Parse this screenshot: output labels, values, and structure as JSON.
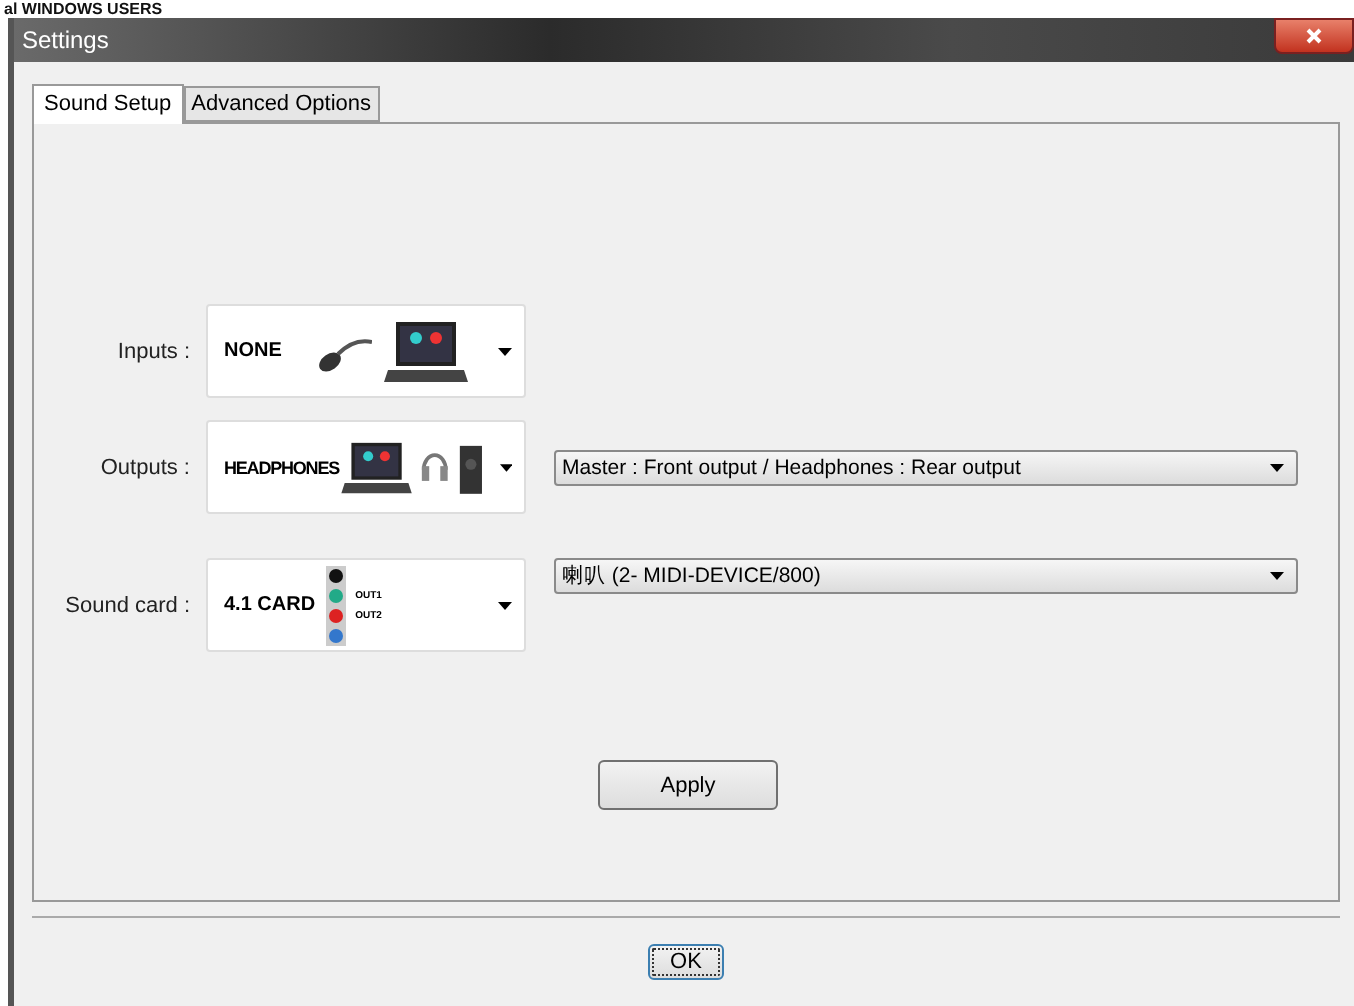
{
  "page_heading": "al WINDOWS USERS",
  "window": {
    "title": "Settings"
  },
  "tabs": [
    {
      "label": "Sound Setup",
      "selected": true
    },
    {
      "label": "Advanced Options",
      "selected": false
    }
  ],
  "rows": [
    {
      "label": "Inputs :",
      "kind": "inputs",
      "card_text": "NONE"
    },
    {
      "label": "Outputs :",
      "kind": "outputs",
      "card_text": "HEADPHONES",
      "select_value": "Master : Front output / Headphones : Rear output"
    },
    {
      "label": "Sound card :",
      "kind": "soundcard",
      "card_text": "4.1 CARD",
      "card_sub": [
        "OUT1",
        "OUT2"
      ],
      "select_value": "喇叭 (2- MIDI-DEVICE/800)"
    }
  ],
  "apply_button": "Apply",
  "ok_button": "OK"
}
